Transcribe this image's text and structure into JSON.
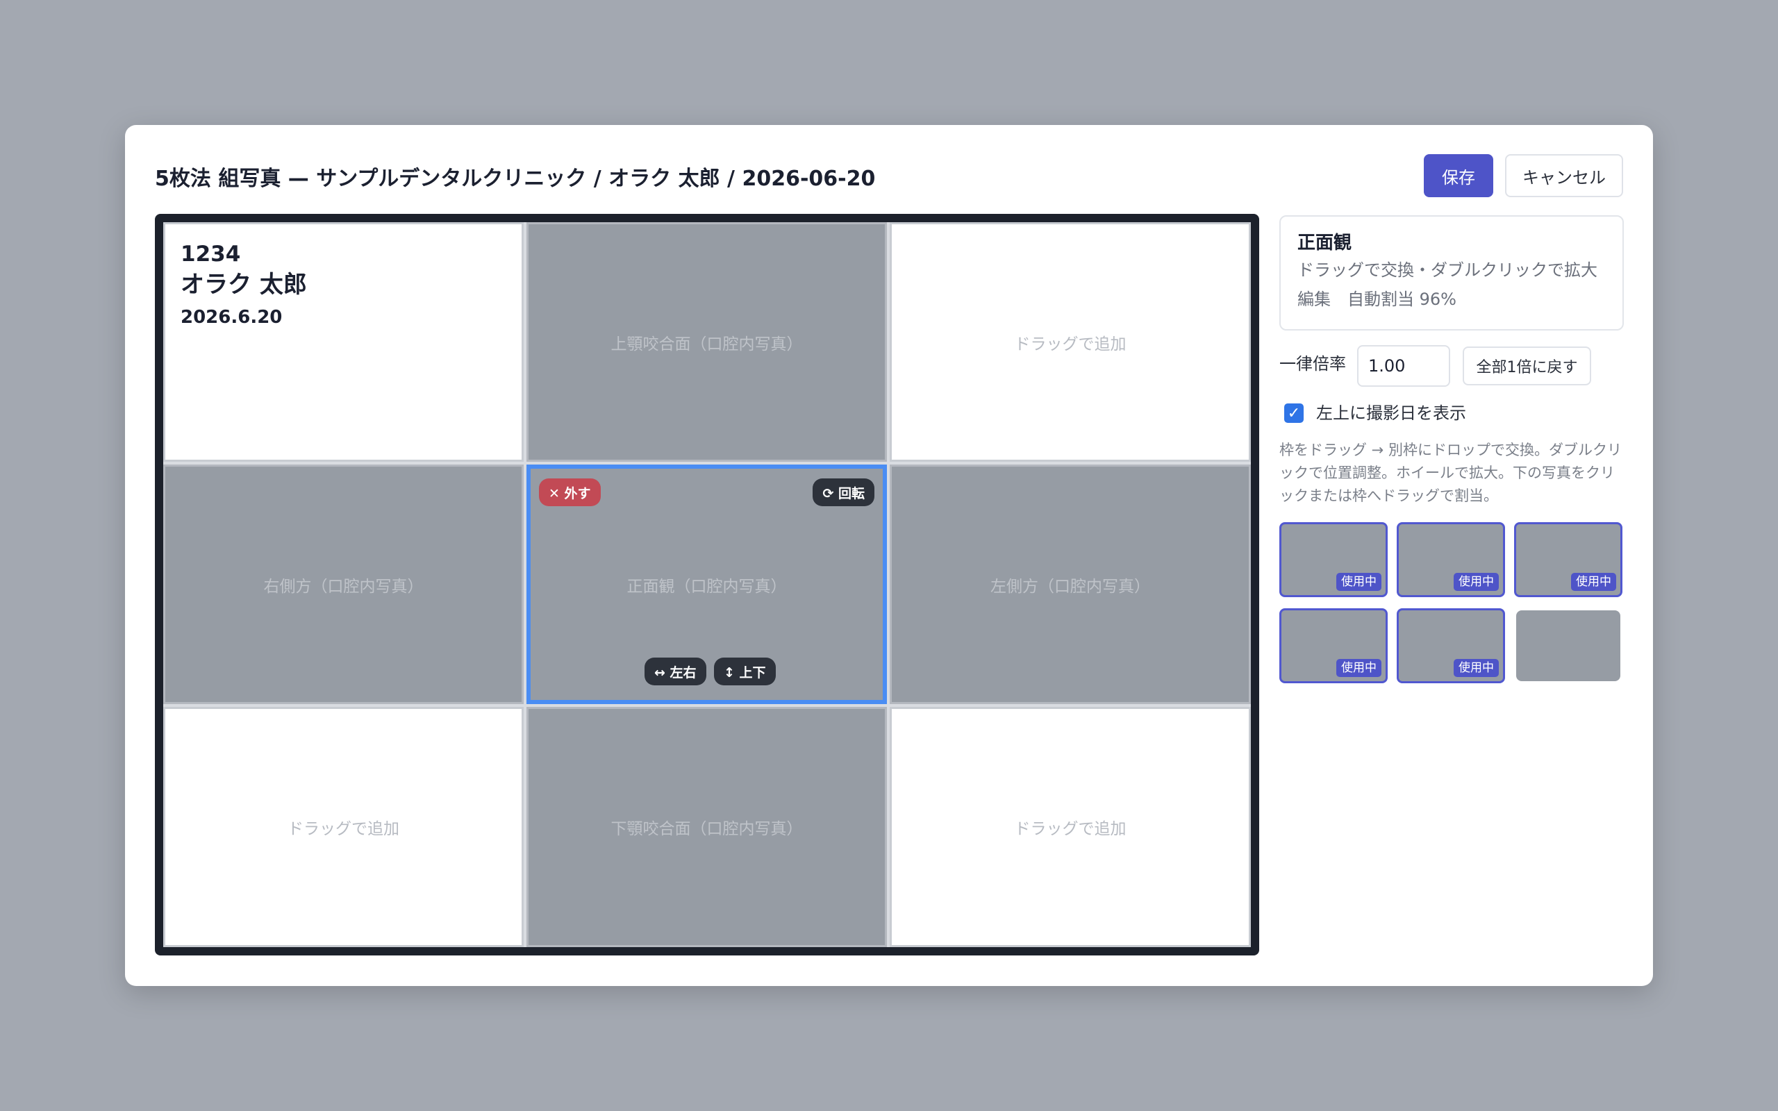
{
  "header": {
    "title": "5枚法 組写真 — サンプルデンタルクリニック / オラク 太郎 / 2026-06-20",
    "save_label": "保存",
    "cancel_label": "キャンセル"
  },
  "info": {
    "id": "1234",
    "name": "オラク 太郎",
    "date": "2026.6.20"
  },
  "cells": {
    "upper": "上顎咬合面（口腔内写真）",
    "top_right": "ドラッグで追加",
    "right_side": "右側方（口腔内写真）",
    "front": "正面観（口腔内写真）",
    "left_side": "左側方（口腔内写真）",
    "bottom_left": "ドラッグで追加",
    "lower": "下顎咬合面（口腔内写真）",
    "bottom_right": "ドラッグで追加"
  },
  "selected_controls": {
    "remove": "✕ 外す",
    "rotate": "⟳ 回転",
    "flip_h": "↔ 左右",
    "flip_v": "↕ 上下"
  },
  "panel": {
    "title": "正面観",
    "hint": "ドラッグで交換・ダブルクリックで拡大",
    "edit_status": "編集　自動割当 96%",
    "scale_label": "一律倍率",
    "scale_value": "1.00",
    "reset_label": "全部1倍に戻す",
    "show_date_label": "左上に撮影日を表示",
    "show_date_checked": true,
    "help_text": "枠をドラッグ → 別枠にドロップで交換。ダブルクリックで位置調整。ホイールで拡大。下の写真をクリックまたは枠へドラッグで割当。"
  },
  "thumbnails": [
    {
      "badge": "使用中"
    },
    {
      "badge": "使用中"
    },
    {
      "badge": "使用中"
    },
    {
      "badge": "使用中"
    },
    {
      "badge": "使用中"
    },
    {
      "badge": ""
    }
  ],
  "colors": {
    "primary": "#4e54c8",
    "selected_border": "#4a8df3",
    "remove_chip": "#c24a55",
    "backdrop": "#a3a8b1"
  }
}
